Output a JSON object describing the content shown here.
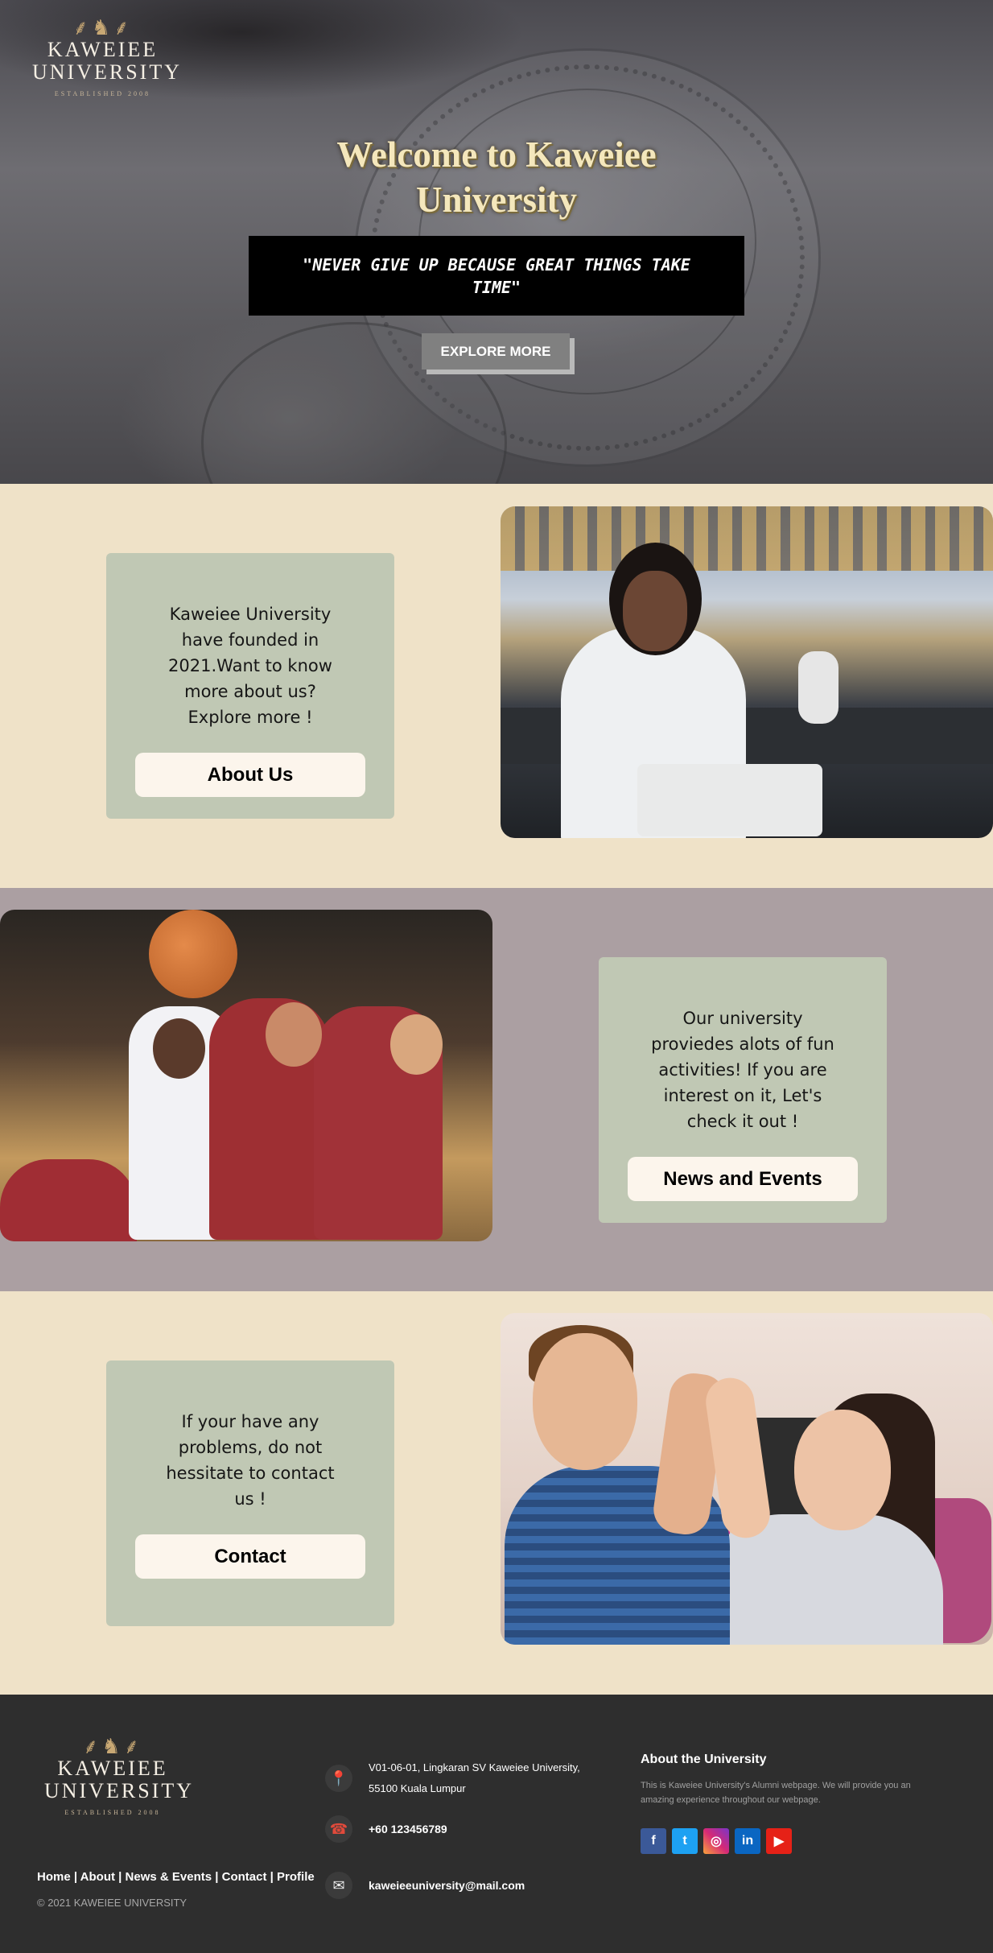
{
  "logo": {
    "line1": "KAWEIEE",
    "line2": "UNIVERSITY",
    "established": "ESTABLISHED 2008"
  },
  "hero": {
    "title": "Welcome to Kaweiee University",
    "quote": "\"NEVER GIVE UP BECAUSE GREAT THINGS TAKE TIME\"",
    "button": "EXPLORE MORE"
  },
  "sections": [
    {
      "text": "Kaweiee University have founded in 2021.Want to know more about us? Explore more !",
      "button": "About Us"
    },
    {
      "text": "Our university proviedes alots of fun activities! If you are interest on it, Let's check it out !",
      "button": "News and Events"
    },
    {
      "text": "If your have any problems, do not hessitate to contact us !",
      "button": "Contact"
    }
  ],
  "footer": {
    "nav": [
      "Home",
      "About",
      "News & Events",
      "Contact",
      "Profile"
    ],
    "copyright": "© 2021 KAWEIEE UNIVERSITY",
    "address": "V01-06-01, Lingkaran SV Kaweiee University, 55100 Kuala Lumpur",
    "phone": "+60 123456789",
    "email": "kaweieeuniversity@mail.com",
    "about_title": "About the University",
    "about_text": "This is Kaweiee University's Alumni webpage. We will provide you an amazing experience throughout our webpage.",
    "socials": [
      {
        "icon": "facebook-icon",
        "glyph": "f",
        "color": "#3b5998"
      },
      {
        "icon": "twitter-icon",
        "glyph": "t",
        "color": "#1da1f2"
      },
      {
        "icon": "instagram-icon",
        "glyph": "◎",
        "color": "#c13584"
      },
      {
        "icon": "linkedin-icon",
        "glyph": "in",
        "color": "#0a66c2"
      },
      {
        "icon": "youtube-icon",
        "glyph": "▶",
        "color": "#e62117"
      }
    ]
  }
}
